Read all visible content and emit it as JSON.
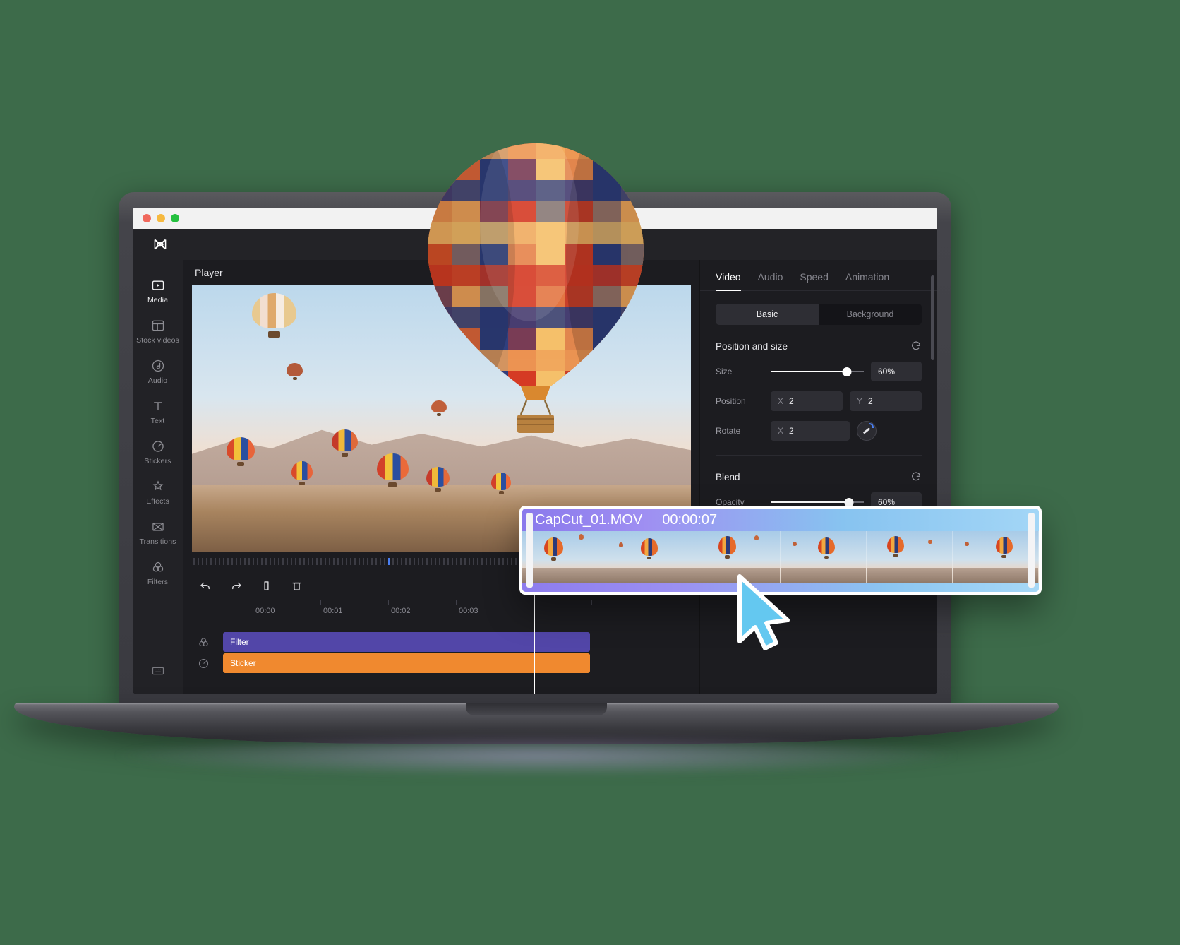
{
  "window": {
    "traffic_lights": [
      "close",
      "minimize",
      "zoom"
    ],
    "app_logo": "capcut-logo-icon"
  },
  "sidebar": {
    "items": [
      {
        "label": "Media",
        "icon": "media-icon",
        "active": true
      },
      {
        "label": "Stock videos",
        "icon": "stock-videos-icon",
        "active": false
      },
      {
        "label": "Audio",
        "icon": "audio-icon",
        "active": false
      },
      {
        "label": "Text",
        "icon": "text-icon",
        "active": false
      },
      {
        "label": "Stickers",
        "icon": "stickers-icon",
        "active": false
      },
      {
        "label": "Effects",
        "icon": "effects-icon",
        "active": false
      },
      {
        "label": "Transitions",
        "icon": "transitions-icon",
        "active": false
      },
      {
        "label": "Filters",
        "icon": "filters-icon",
        "active": false
      }
    ],
    "bottom_icon": "keyboard-shortcuts-icon"
  },
  "player": {
    "title": "Player"
  },
  "inspector": {
    "tabs": [
      {
        "label": "Video",
        "active": true
      },
      {
        "label": "Audio",
        "active": false
      },
      {
        "label": "Speed",
        "active": false
      },
      {
        "label": "Animation",
        "active": false
      }
    ],
    "segments": [
      {
        "label": "Basic",
        "active": true
      },
      {
        "label": "Background",
        "active": false
      }
    ],
    "position_and_size": {
      "heading": "Position and size",
      "reset_icon": "reset-icon",
      "size": {
        "label": "Size",
        "value": "60%",
        "slider_percent": 82
      },
      "position": {
        "label": "Position",
        "x_axis": "X",
        "x_value": "2",
        "y_axis": "Y",
        "y_value": "2"
      },
      "rotate": {
        "label": "Rotate",
        "x_axis": "X",
        "x_value": "2",
        "knob_icon": "rotate-knob-icon"
      }
    },
    "blend": {
      "heading": "Blend",
      "reset_icon": "reset-icon",
      "opacity": {
        "label": "Opacity",
        "value": "60%",
        "slider_percent": 84
      }
    }
  },
  "timeline": {
    "tools": [
      {
        "name": "undo-icon",
        "label": "Undo"
      },
      {
        "name": "redo-icon",
        "label": "Redo"
      },
      {
        "name": "split-icon",
        "label": "Split"
      },
      {
        "name": "delete-icon",
        "label": "Delete"
      }
    ],
    "ruler_labels": [
      "00:00",
      "00:01",
      "00:02",
      "00:03"
    ],
    "tracks": [
      {
        "icon": "filters-icon",
        "label": "Filter",
        "color": "#5246a8"
      },
      {
        "icon": "stickers-icon",
        "label": "Sticker",
        "color": "#f0892f"
      }
    ]
  },
  "clip_card": {
    "filename": "CapCut_01.MOV",
    "duration": "00:00:07",
    "frame_count": 6,
    "left_handle": "trim-handle-left",
    "right_handle": "trim-handle-right"
  },
  "colors": {
    "accent_purple": "#8a79ec",
    "accent_blue": "#4a7ff2",
    "track_filter": "#5246a8",
    "track_sticker": "#f0892f",
    "app_bg": "#1c1c20",
    "panel_bg": "#222226",
    "page_bg": "#3d6b4a"
  }
}
